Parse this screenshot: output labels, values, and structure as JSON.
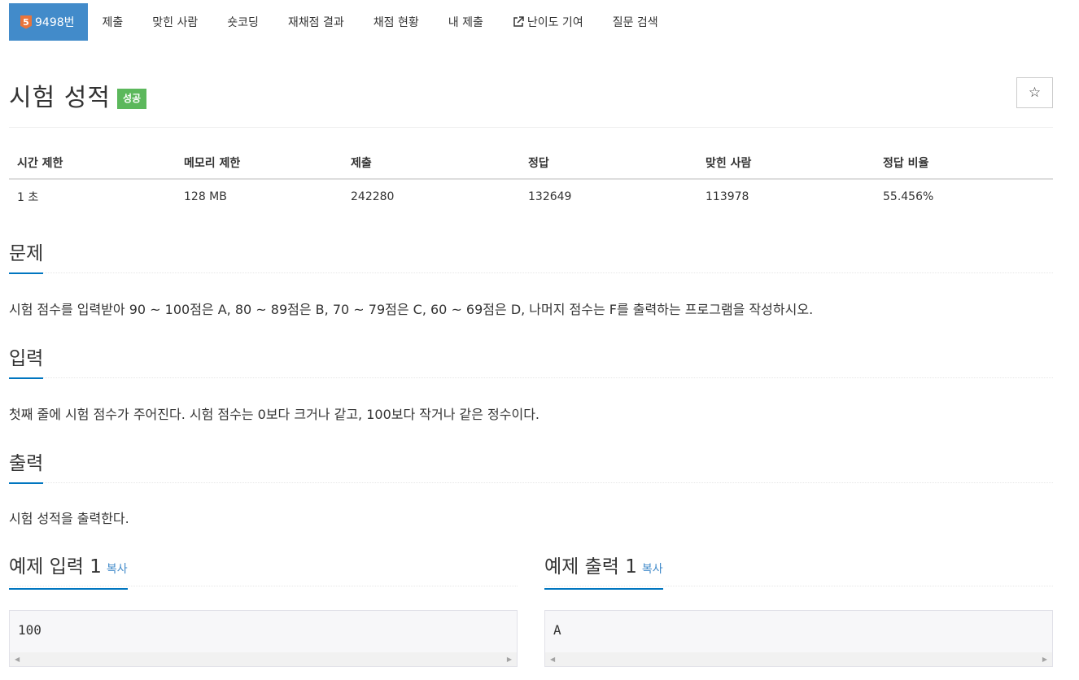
{
  "nav": {
    "problem_tab": {
      "tier": "5",
      "label": "9498번"
    },
    "items": [
      "제출",
      "맞힌 사람",
      "숏코딩",
      "재채점 결과",
      "채점 현황",
      "내 제출",
      "난이도 기여",
      "질문 검색"
    ],
    "external_icon": "external-link-icon"
  },
  "problem": {
    "title": "시험 성적",
    "status_badge": "성공",
    "star_icon": "☆"
  },
  "info_table": {
    "headers": [
      "시간 제한",
      "메모리 제한",
      "제출",
      "정답",
      "맞힌 사람",
      "정답 비율"
    ],
    "values": [
      "1 초",
      "128 MB",
      "242280",
      "132649",
      "113978",
      "55.456%"
    ]
  },
  "sections": {
    "description": {
      "heading": "문제",
      "text": "시험 점수를 입력받아 90 ~ 100점은 A, 80 ~ 89점은 B, 70 ~ 79점은 C, 60 ~ 69점은 D, 나머지 점수는 F를 출력하는 프로그램을 작성하시오."
    },
    "input": {
      "heading": "입력",
      "text": "첫째 줄에 시험 점수가 주어진다. 시험 점수는 0보다 크거나 같고, 100보다 작거나 같은 정수이다."
    },
    "output": {
      "heading": "출력",
      "text": "시험 성적을 출력한다."
    }
  },
  "samples": {
    "input": {
      "heading": "예제 입력 1",
      "copy": "복사",
      "content": "100"
    },
    "output": {
      "heading": "예제 출력 1",
      "copy": "복사",
      "content": "A"
    },
    "scroll_left": "◀",
    "scroll_right": "▶"
  },
  "colors": {
    "active_tab": "#428bca",
    "success": "#5cb85c",
    "tier_badge": "#e8743b",
    "heading_underline": "#0076c0"
  }
}
